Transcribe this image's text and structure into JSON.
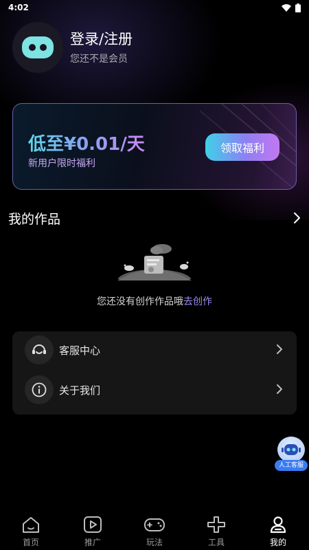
{
  "status_bar": {
    "time": "4:02"
  },
  "profile": {
    "title": "登录/注册",
    "subtitle": "您还不是会员"
  },
  "promo": {
    "price": "低至¥0.01/天",
    "subtitle": "新用户限时福利",
    "button": "领取福利"
  },
  "works": {
    "title": "我的作品",
    "empty_text": "您还没有创作作品哦",
    "empty_link": "去创作"
  },
  "menu": {
    "items": [
      {
        "label": "客服中心",
        "icon": "headset-icon"
      },
      {
        "label": "关于我们",
        "icon": "info-icon"
      }
    ]
  },
  "float_service": {
    "label": "人工客服"
  },
  "tabbar": {
    "tabs": [
      {
        "label": "首页",
        "icon": "home-icon"
      },
      {
        "label": "推广",
        "icon": "play-icon"
      },
      {
        "label": "玩法",
        "icon": "gamepad-icon"
      },
      {
        "label": "工具",
        "icon": "tools-icon"
      },
      {
        "label": "我的",
        "icon": "user-icon",
        "active": true
      }
    ]
  },
  "colors": {
    "background": "#000000",
    "accent": "#9a8ef5",
    "cyan": "#3fd1e8",
    "card": "#161616"
  }
}
